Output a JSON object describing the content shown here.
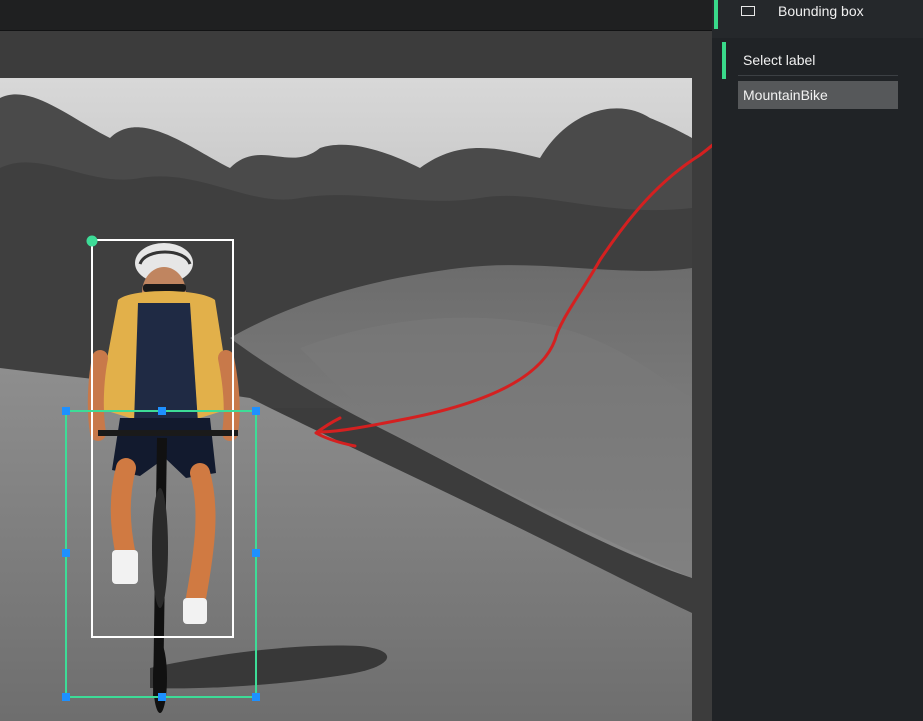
{
  "toolbar": {
    "tool_label": "Bounding box",
    "tool_icon": "rectangle-icon",
    "accent_color": "#39d98a"
  },
  "labels": {
    "header": "Select label",
    "options": [
      "MountainBike"
    ]
  },
  "annotations": {
    "person_box_color": "#ffffff",
    "bike_box_color": "#3ddc97",
    "handle_color": "#1e90ff",
    "arrow_color": "#d42020"
  }
}
